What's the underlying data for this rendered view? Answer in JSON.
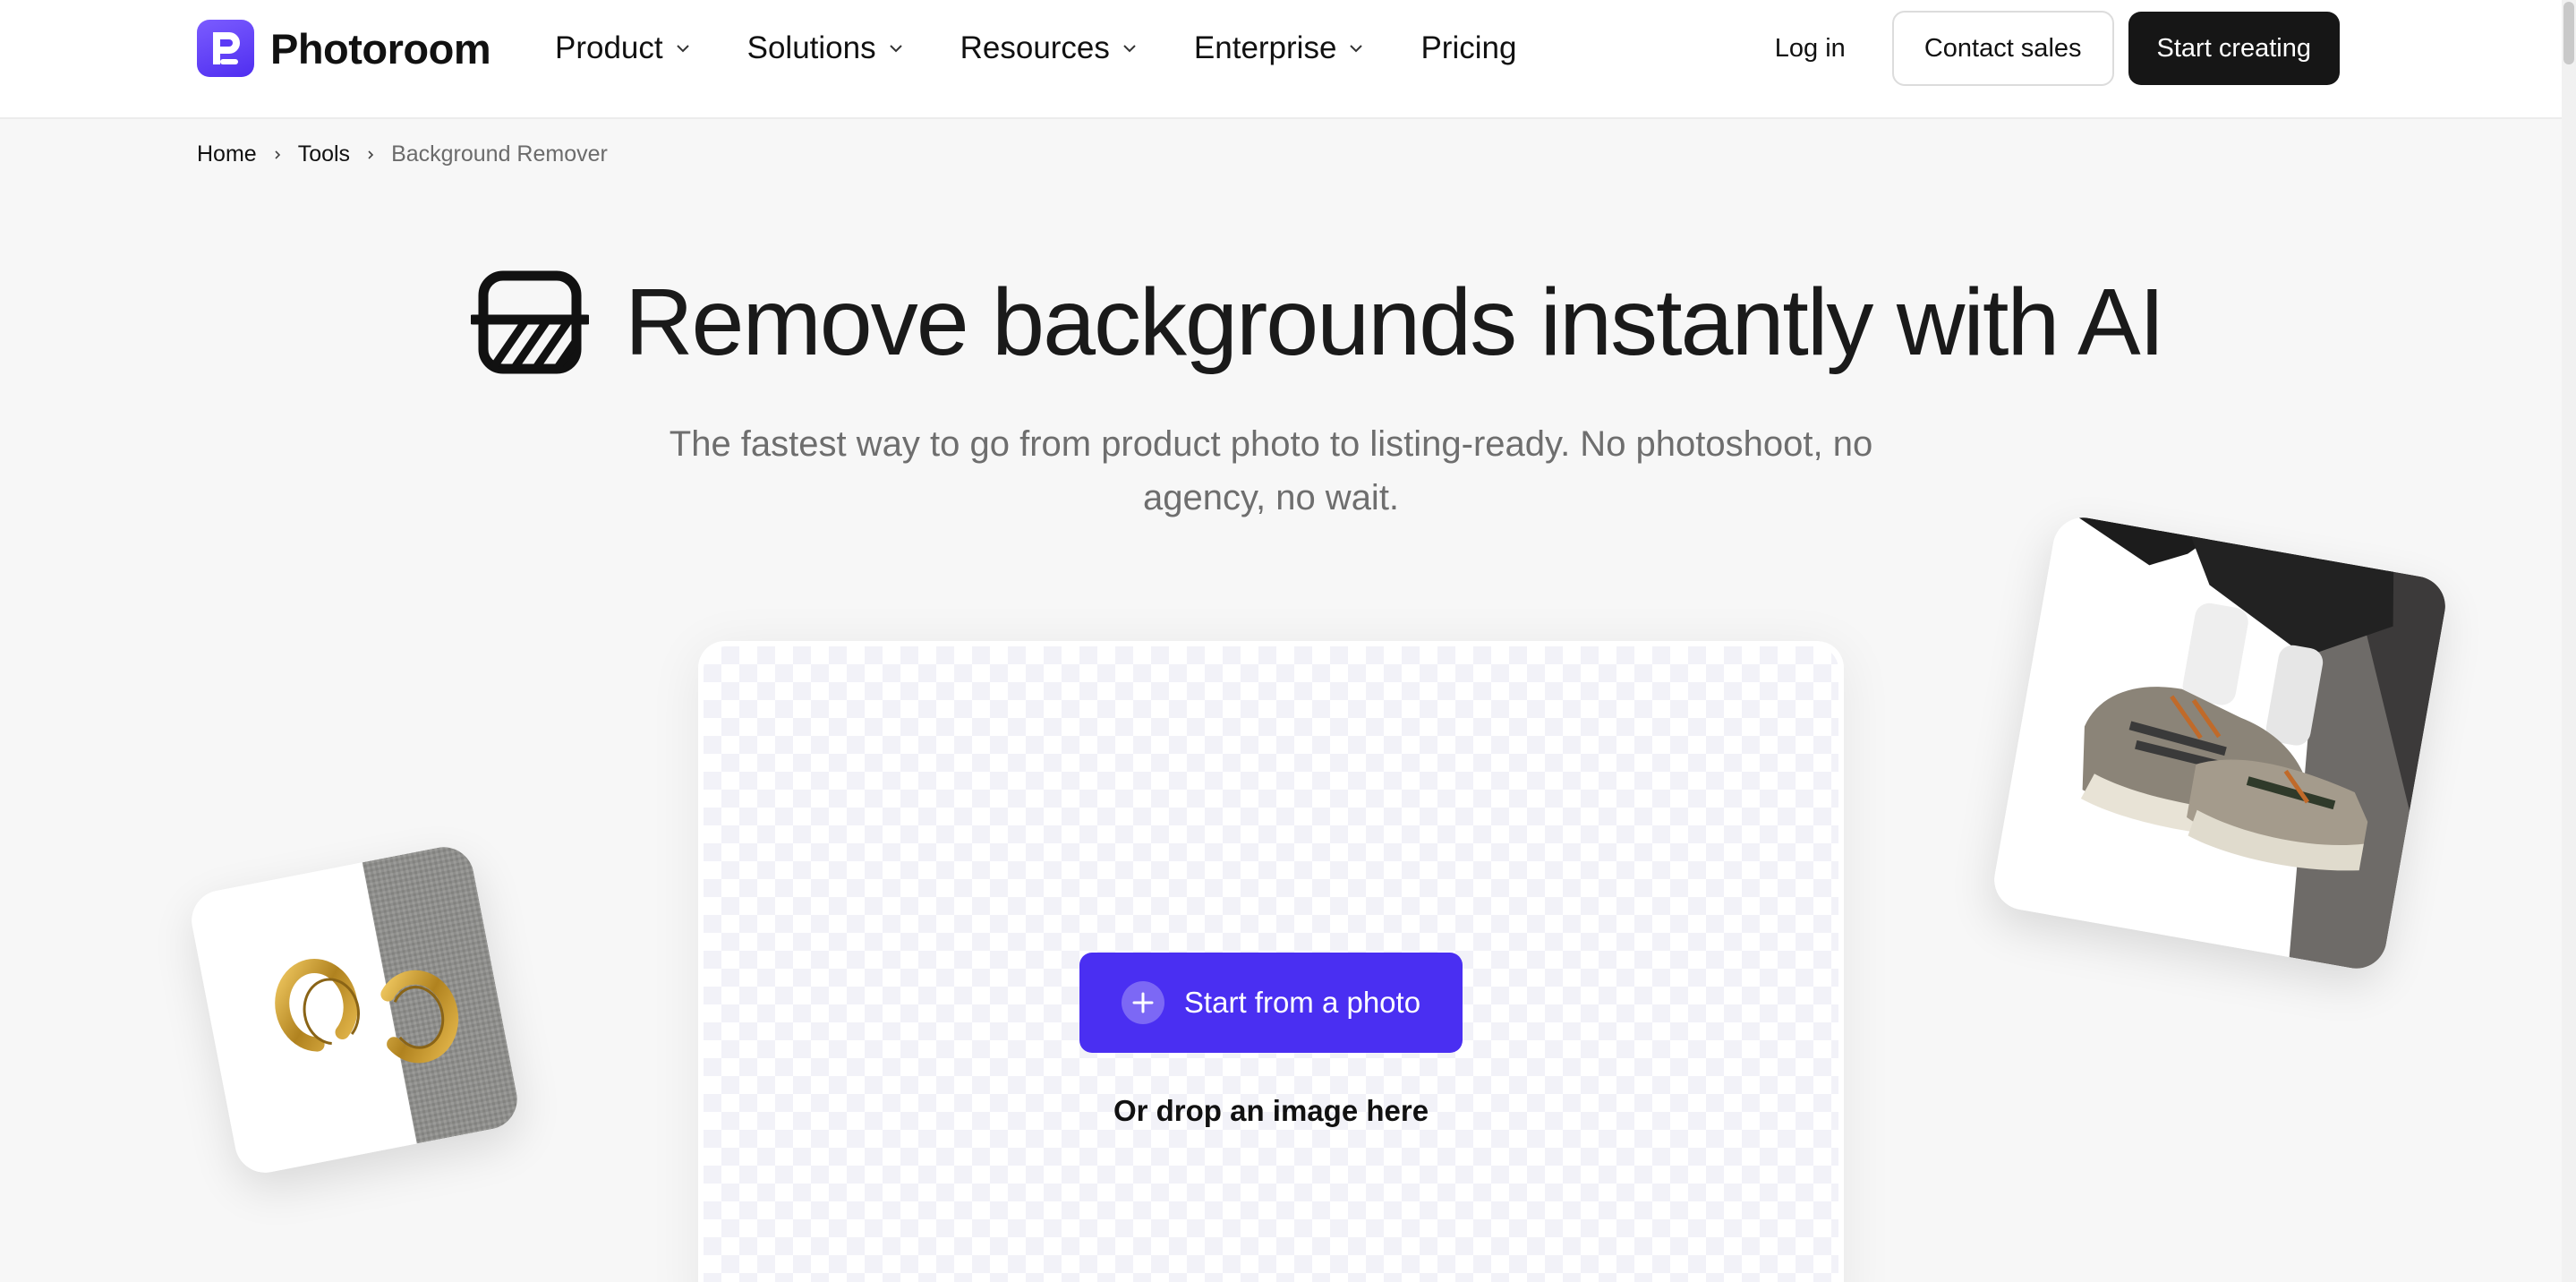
{
  "header": {
    "logo_text": "Photoroom",
    "nav": [
      {
        "label": "Product",
        "has_dropdown": true
      },
      {
        "label": "Solutions",
        "has_dropdown": true
      },
      {
        "label": "Resources",
        "has_dropdown": true
      },
      {
        "label": "Enterprise",
        "has_dropdown": true
      },
      {
        "label": "Pricing",
        "has_dropdown": false
      }
    ],
    "login_label": "Log in",
    "contact_label": "Contact sales",
    "start_label": "Start creating"
  },
  "breadcrumb": {
    "items": [
      "Home",
      "Tools",
      "Background Remover"
    ]
  },
  "hero": {
    "title": "Remove backgrounds instantly with AI",
    "subtitle": "The fastest way to go from product photo to listing-ready. No photoshoot, no agency, no wait."
  },
  "upload": {
    "button_label": "Start from a photo",
    "drop_text": "Or drop an image here"
  },
  "colors": {
    "brand_purple": "#4a2ff2",
    "dark_button": "#161616",
    "page_background": "#f7f7f7"
  },
  "icons": {
    "logo": "photoroom-logo-icon",
    "hero": "background-remover-icon",
    "dropdown": "chevron-down-icon",
    "breadcrumb_sep": "chevron-right-icon",
    "upload": "plus-icon"
  }
}
